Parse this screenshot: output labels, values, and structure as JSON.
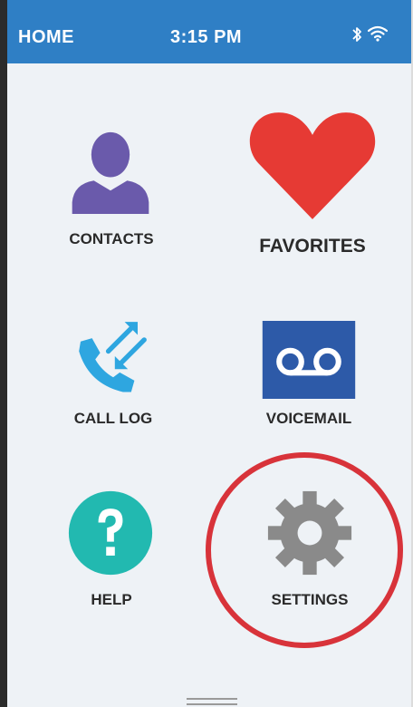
{
  "statusbar": {
    "title": "HOME",
    "time": "3:15 PM",
    "icons": [
      "bluetooth-icon",
      "wifi-icon"
    ]
  },
  "tiles": [
    {
      "id": "contacts",
      "label": "CONTACTS",
      "icon": "person-icon",
      "color": "#6a5aab"
    },
    {
      "id": "favorites",
      "label": "FAVORITES",
      "icon": "heart-icon",
      "color": "#e63a34"
    },
    {
      "id": "call-log",
      "label": "CALL LOG",
      "icon": "phone-arrows-icon",
      "color": "#2ea6e0"
    },
    {
      "id": "voicemail",
      "label": "VOICEMAIL",
      "icon": "voicemail-icon",
      "color": "#2d5aa8"
    },
    {
      "id": "help",
      "label": "HELP",
      "icon": "question-mark-icon",
      "color": "#22b9b0"
    },
    {
      "id": "settings",
      "label": "SETTINGS",
      "icon": "gear-icon",
      "color": "#8a8a8a"
    }
  ],
  "highlight": {
    "target": "settings",
    "color": "#d8333a"
  }
}
